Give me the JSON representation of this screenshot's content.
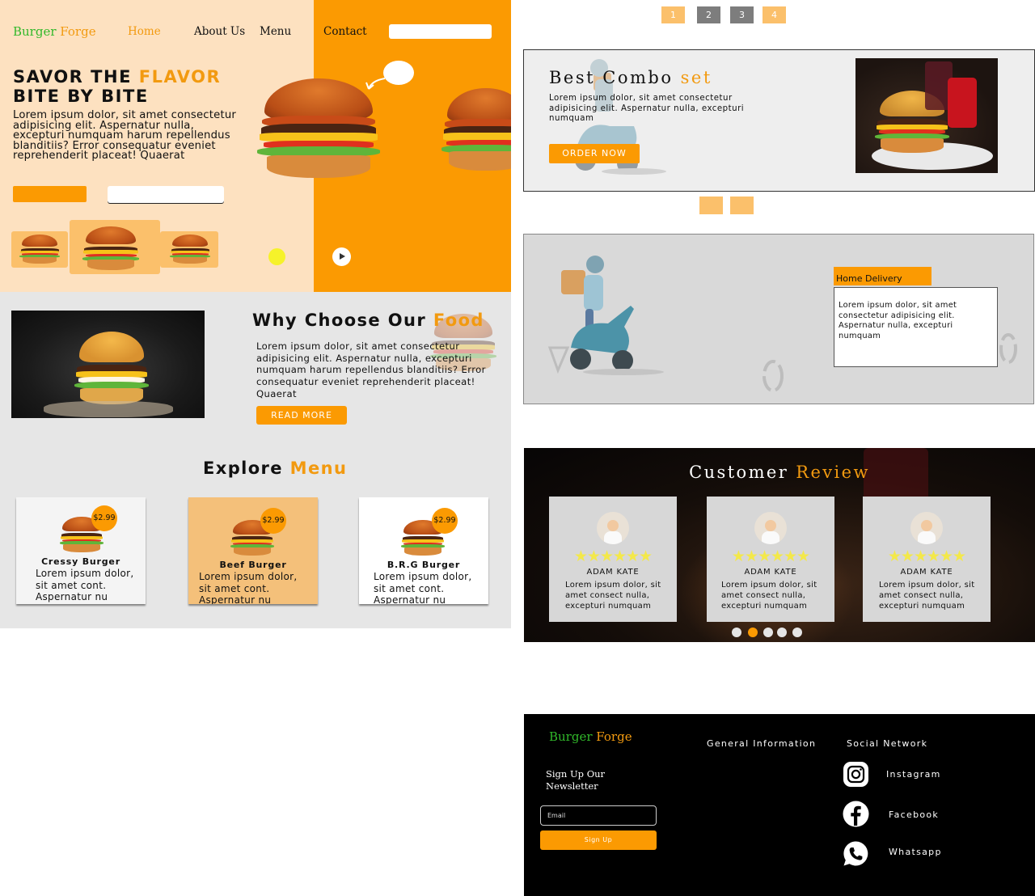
{
  "brand": {
    "name_part1": "Burger",
    "name_part2": "Forge"
  },
  "nav": {
    "items": [
      "Home",
      "About Us",
      "Menu",
      "Contact"
    ],
    "active": "Home"
  },
  "hero": {
    "title_line1_a": "SAVOR THE ",
    "title_line1_b": "FLAVOR",
    "title_line2": "BITE BY BITE",
    "body": "Lorem ipsum dolor, sit amet consectetur adipisicing elit. Aspernatur nulla, excepturi numquam harum repellendus blanditiis? Error consequatur eveniet reprehenderit placeat! Quaerat"
  },
  "why": {
    "title_a": "Why Choose Our ",
    "title_b": "Food",
    "body": "Lorem ipsum dolor, sit amet consectetur adipisicing elit. Aspernatur nulla, excepturi numquam harum repellendus blanditiis? Error consequatur eveniet reprehenderit placeat! Quaerat",
    "button": "READ MORE"
  },
  "explore": {
    "title_a": "Explore ",
    "title_b": "Menu",
    "cards": [
      {
        "name": "Cressy Burger",
        "price": "$2.99",
        "desc": "Lorem ipsum dolor, sit amet cont. Aspernatur nu"
      },
      {
        "name": "Beef Burger",
        "price": "$2.99",
        "desc": "Lorem ipsum dolor, sit amet cont. Aspernatur nu"
      },
      {
        "name": "B.R.G Burger",
        "price": "$2.99",
        "desc": "Lorem ipsum dolor, sit amet cont. Aspernatur nu"
      }
    ]
  },
  "pagination": [
    "1",
    "2",
    "3",
    "4"
  ],
  "combo": {
    "title_a": "Best Combo ",
    "title_b": "set",
    "body": "Lorem ipsum dolor, sit amet consectetur adipisicing elit. Aspernatur nulla, excepturi numquam",
    "button": "ORDER NOW"
  },
  "delivery": {
    "tab": "Home Delivery",
    "body": "Lorem ipsum dolor, sit amet consectetur adipisicing elit. Aspernatur nulla, excepturi numquam"
  },
  "reviews": {
    "title_a": "Customer ",
    "title_b": "Review",
    "items": [
      {
        "stars": "★★★★★★",
        "name": "ADAM KATE",
        "body": "Lorem ipsum dolor, sit amet consect nulla, excepturi numquam"
      },
      {
        "stars": "★★★★★★",
        "name": "ADAM KATE",
        "body": "Lorem ipsum dolor, sit amet consect nulla, excepturi numquam"
      },
      {
        "stars": "★★★★★★",
        "name": "ADAM KATE",
        "body": "Lorem ipsum dolor, sit amet consect nulla, excepturi numquam"
      }
    ]
  },
  "footer": {
    "general_heading": "General Information",
    "social_heading": "Social Network",
    "newsletter_line1": "Sign Up Our",
    "newsletter_line2": "Newsletter",
    "email_placeholder": "Email",
    "signup_button": "Sign Up",
    "social": [
      {
        "icon": "instagram-icon",
        "label": "Instagram"
      },
      {
        "icon": "facebook-icon",
        "label": "Facebook"
      },
      {
        "icon": "whatsapp-icon",
        "label": "Whatsapp"
      }
    ]
  },
  "colors": {
    "accent": "#fb9a02",
    "peach": "#fde1c0",
    "gray": "#e6e6e6",
    "green": "#31b82a"
  }
}
